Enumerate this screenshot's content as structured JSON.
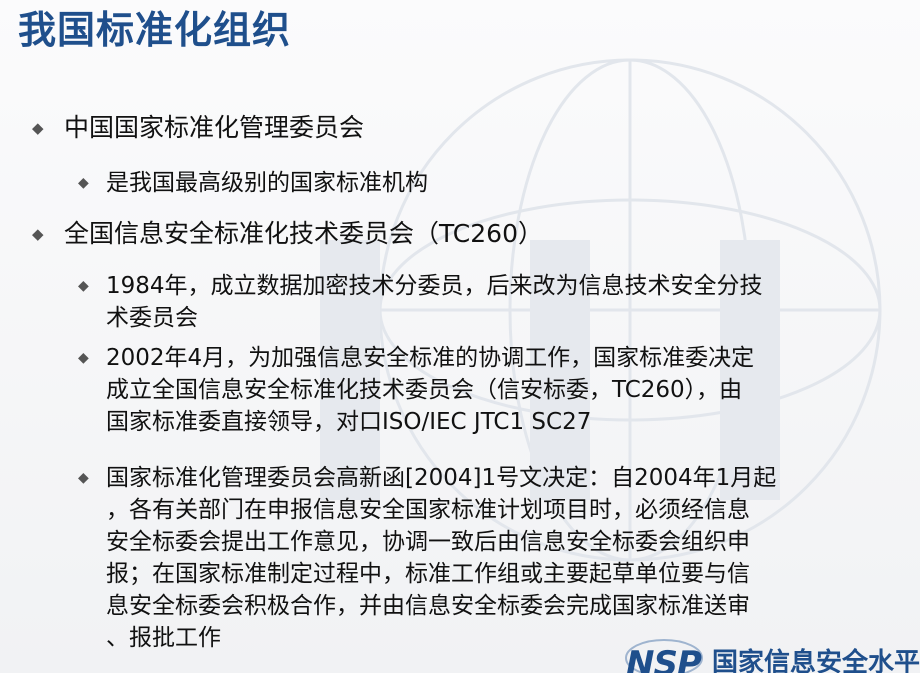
{
  "slide": {
    "title": "我国标准化组织",
    "bullets": [
      {
        "level": 1,
        "lines": [
          "中国国家标准化管理委员会"
        ]
      },
      {
        "level": 2,
        "lines": [
          "是我国最高级别的国家标准机构"
        ]
      },
      {
        "level": 1,
        "lines": [
          "全国信息安全标准化技术委员会（TC260）"
        ]
      },
      {
        "level": 2,
        "lines": [
          "1984年，成立数据加密技术分委员，后来改为信息技术安全分技",
          "术委员会"
        ]
      },
      {
        "level": 2,
        "lines": [
          "2002年4月，为加强信息安全标准的协调工作，国家标准委决定",
          "成立全国信息安全标准化技术委员会（信安标委，TC260），由",
          "国家标准委直接领导，对口ISO/IEC JTC1 SC27"
        ]
      },
      {
        "level": 2,
        "lines": [
          "国家标准化管理委员会高新函[2004]1号文决定：自2004年1月起",
          "，各有关部门在申报信息安全国家标准计划项目时，必须经信息",
          "安全标委会提出工作意见，协调一致后由信息安全标委会组织申",
          "报；在国家标准制定过程中，标准工作组或主要起草单位要与信",
          "息安全标委会积极合作，并由信息安全标委会完成国家标准送审",
          "、报批工作"
        ]
      }
    ],
    "bullet_mark": "◆"
  },
  "logo": {
    "mark_text": "NSP",
    "org_text": "国家信息安全水平考试"
  },
  "colors": {
    "title": "#1f4f8c",
    "text": "#111111",
    "bullet_mark": "#555555",
    "logo": "#1f4f8c"
  }
}
